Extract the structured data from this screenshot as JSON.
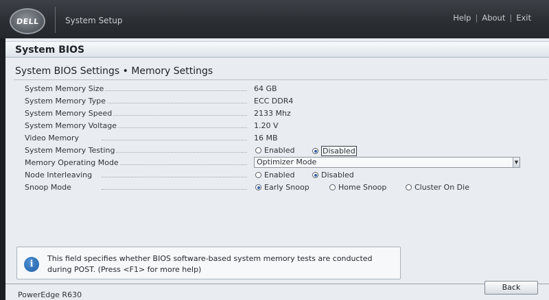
{
  "header": {
    "logo_text": "DELL",
    "app_title": "System Setup",
    "links": [
      "Help",
      "About",
      "Exit"
    ],
    "separator": "|"
  },
  "section": {
    "title": "System BIOS",
    "subtitle": "System BIOS Settings • Memory Settings"
  },
  "settings": {
    "system_memory_size": {
      "label": "System Memory Size",
      "value": "64 GB"
    },
    "system_memory_type": {
      "label": "System Memory Type",
      "value": "ECC DDR4"
    },
    "system_memory_speed": {
      "label": "System Memory Speed",
      "value": "2133 Mhz"
    },
    "system_memory_voltage": {
      "label": "System Memory Voltage",
      "value": "1.20 V"
    },
    "video_memory": {
      "label": "Video Memory",
      "value": "16 MB"
    },
    "system_memory_testing": {
      "label": "System Memory Testing",
      "options": [
        "Enabled",
        "Disabled"
      ],
      "selected": "Disabled"
    },
    "memory_operating_mode": {
      "label": "Memory Operating Mode",
      "selected": "Optimizer Mode"
    },
    "node_interleaving": {
      "label": "Node Interleaving",
      "options": [
        "Enabled",
        "Disabled"
      ],
      "selected": "Disabled"
    },
    "snoop_mode": {
      "label": "Snoop Mode",
      "options": [
        "Early Snoop",
        "Home Snoop",
        "Cluster On Die"
      ],
      "selected": "Early Snoop"
    }
  },
  "help": {
    "icon": "info-icon",
    "text_line1": "This field specifies whether BIOS software-based system memory tests are conducted",
    "text_line2": "during POST. (Press <F1> for more help)"
  },
  "footer": {
    "model": "PowerEdge R630",
    "back_label": "Back"
  },
  "colors": {
    "header_bg": "#2a2d32",
    "panel_bg": "#e9edf1",
    "radio_selected": "#2f5fa8",
    "info_icon": "#1f5fa7"
  }
}
